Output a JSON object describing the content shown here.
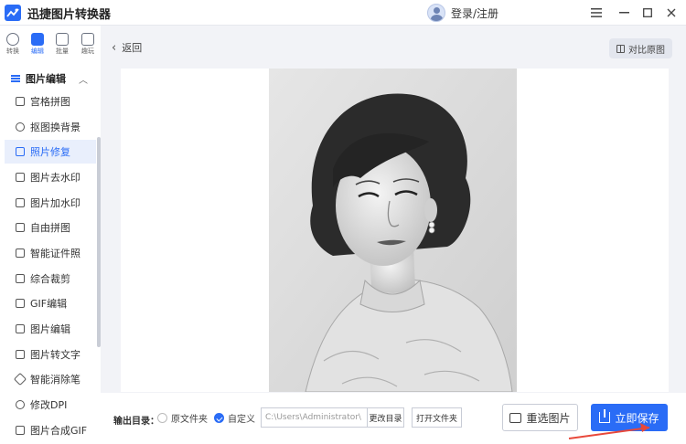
{
  "app": {
    "title": "迅捷图片转换器",
    "login_label": "登录/注册"
  },
  "window": {
    "menu_icon": "hamburger-icon",
    "minimize_icon": "minimize-icon",
    "maximize_icon": "maximize-icon",
    "close_icon": "close-icon"
  },
  "rail": [
    {
      "label": "转换",
      "icon": "convert-icon",
      "active": false
    },
    {
      "label": "编辑",
      "icon": "edit-icon",
      "active": true
    },
    {
      "label": "批量",
      "icon": "batch-icon",
      "active": false
    },
    {
      "label": "趣玩",
      "icon": "fun-icon",
      "active": false
    }
  ],
  "sidebar": {
    "section": "图片编辑",
    "items": [
      {
        "label": "宫格拼图"
      },
      {
        "label": "抠图换背景"
      },
      {
        "label": "照片修复",
        "active": true
      },
      {
        "label": "图片去水印"
      },
      {
        "label": "图片加水印"
      },
      {
        "label": "自由拼图"
      },
      {
        "label": "智能证件照"
      },
      {
        "label": "综合裁剪"
      },
      {
        "label": "GIF编辑"
      },
      {
        "label": "图片编辑"
      },
      {
        "label": "图片转文字"
      },
      {
        "label": "智能消除笔"
      },
      {
        "label": "修改DPI"
      },
      {
        "label": "图片合成GIF"
      }
    ]
  },
  "main": {
    "back_label": "返回",
    "compare_label": "对比原图"
  },
  "bottom": {
    "output_label": "输出目录：",
    "option_original": "原文件夹",
    "option_custom": "自定义",
    "path_value": "C:\\Users\\Administrator\\",
    "change_dir_label": "更改目录",
    "open_folder_label": "打开文件夹",
    "reselect_label": "重选图片",
    "save_label": "立即保存"
  },
  "colors": {
    "accent": "#2a6cf6",
    "annotation_arrow": "#e8483a"
  }
}
